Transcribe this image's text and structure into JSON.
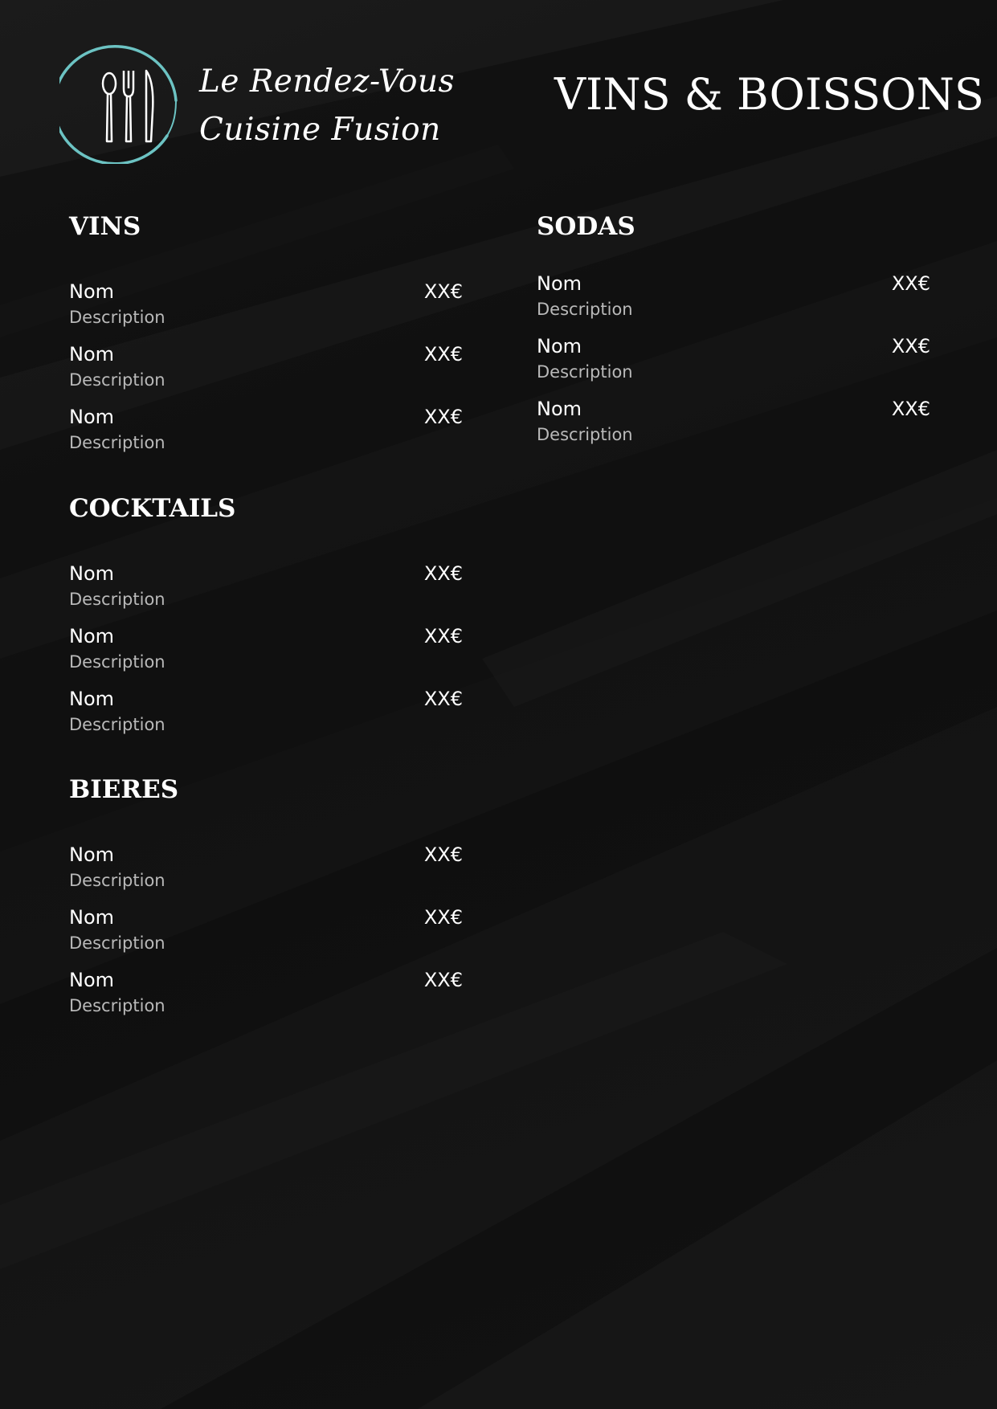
{
  "colors": {
    "background": "#151515",
    "logo_ring": "#6cc3c3",
    "text": "#ffffff",
    "description": "#b9b9b9"
  },
  "logo": {
    "icon": "cutlery-ring-icon"
  },
  "header": {
    "restaurant_line1": "Le Rendez-Vous",
    "restaurant_line2": "Cuisine Fusion",
    "title": "VINS & BOISSONS"
  },
  "sections": [
    {
      "title": "VINS",
      "items": [
        {
          "name": "Nom",
          "description": "Description",
          "price": "XX€"
        },
        {
          "name": "Nom",
          "description": "Description",
          "price": "XX€"
        },
        {
          "name": "Nom",
          "description": "Description",
          "price": "XX€"
        }
      ]
    },
    {
      "title": "COCKTAILS",
      "items": [
        {
          "name": "Nom",
          "description": "Description",
          "price": "XX€"
        },
        {
          "name": "Nom",
          "description": "Description",
          "price": "XX€"
        },
        {
          "name": "Nom",
          "description": "Description",
          "price": "XX€"
        }
      ]
    },
    {
      "title": "BIERES",
      "items": [
        {
          "name": "Nom",
          "description": "Description",
          "price": "XX€"
        },
        {
          "name": "Nom",
          "description": "Description",
          "price": "XX€"
        },
        {
          "name": "Nom",
          "description": "Description",
          "price": "XX€"
        }
      ]
    },
    {
      "title": "SODAS",
      "items": [
        {
          "name": "Nom",
          "description": "Description",
          "price": "XX€"
        },
        {
          "name": "Nom",
          "description": "Description",
          "price": "XX€"
        },
        {
          "name": "Nom",
          "description": "Description",
          "price": "XX€"
        }
      ]
    }
  ]
}
